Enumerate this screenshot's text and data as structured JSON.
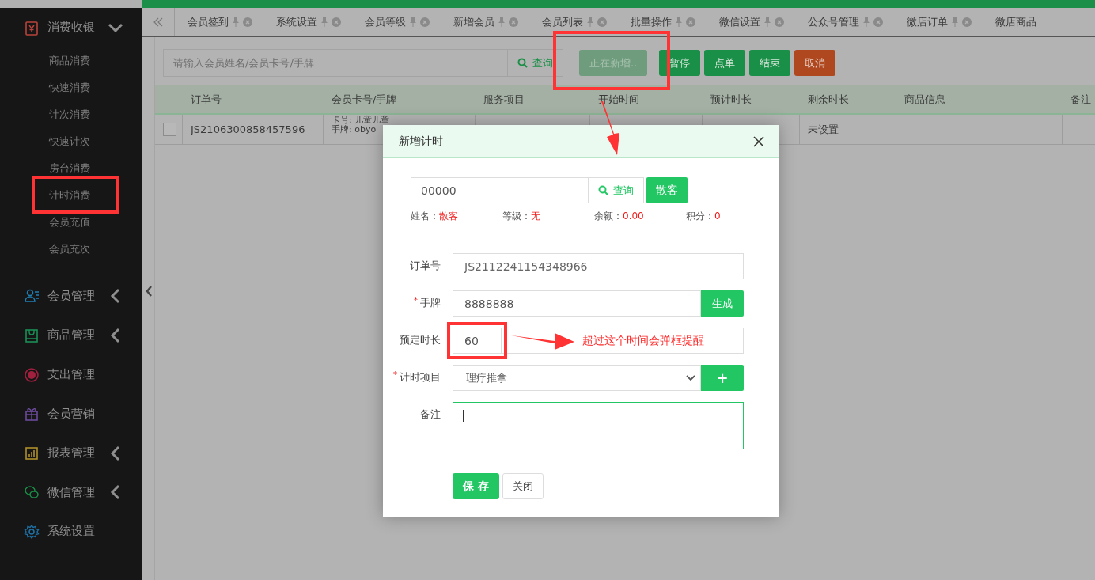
{
  "sidebar": {
    "groups": [
      {
        "label": "消费收银",
        "expanded": true,
        "collapsible": true,
        "children": [
          {
            "label": "商品消费"
          },
          {
            "label": "快速消费"
          },
          {
            "label": "计次消费"
          },
          {
            "label": "快速计次"
          },
          {
            "label": "房台消费"
          },
          {
            "label": "计时消费"
          },
          {
            "label": "会员充值"
          },
          {
            "label": "会员充次"
          }
        ]
      },
      {
        "label": "会员管理",
        "expanded": false,
        "collapsible": true
      },
      {
        "label": "商品管理",
        "expanded": false,
        "collapsible": true
      },
      {
        "label": "支出管理",
        "collapsible": false
      },
      {
        "label": "会员营销",
        "collapsible": false
      },
      {
        "label": "报表管理",
        "expanded": false,
        "collapsible": true
      },
      {
        "label": "微信管理",
        "expanded": false,
        "collapsible": true
      },
      {
        "label": "系统设置",
        "collapsible": false
      }
    ]
  },
  "tabs": [
    {
      "label": "会员签到",
      "closable": true
    },
    {
      "label": "系统设置",
      "closable": true
    },
    {
      "label": "会员等级",
      "closable": true
    },
    {
      "label": "新增会员",
      "closable": true
    },
    {
      "label": "会员列表",
      "closable": true
    },
    {
      "label": "批量操作",
      "closable": true
    },
    {
      "label": "微信设置",
      "closable": true
    },
    {
      "label": "公众号管理",
      "closable": true
    },
    {
      "label": "微店订单",
      "closable": true
    },
    {
      "label": "微店商品",
      "closable": false
    }
  ],
  "toolbar": {
    "search": {
      "placeholder": "请输入会员姓名/会员卡号/手牌"
    },
    "search_button": "查询",
    "buttons": [
      {
        "label": "正在新增..",
        "kind": "disabled"
      },
      {
        "label": "暂停",
        "kind": "primary"
      },
      {
        "label": "点单",
        "kind": "primary"
      },
      {
        "label": "结束",
        "kind": "primary"
      },
      {
        "label": "取消",
        "kind": "danger"
      }
    ]
  },
  "table": {
    "columns": [
      "订单号",
      "会员卡号/手牌",
      "服务项目",
      "开始时间",
      "预计时长",
      "剩余时长",
      "商品信息",
      "备注"
    ],
    "rows": [
      {
        "checked": false,
        "order": "JS2106300858457596",
        "card": "卡号: 儿童儿童",
        "tag": "手牌: obyo",
        "remaining": "未设置"
      }
    ]
  },
  "dialog": {
    "title": "新增计时",
    "member_field": {
      "value": "00000"
    },
    "query_button": "查询",
    "guest_button": "散客",
    "info": [
      {
        "label": "姓名：",
        "value": "散客"
      },
      {
        "label": "等级：",
        "value": "无"
      },
      {
        "label": "余额：",
        "value": "0.00"
      },
      {
        "label": "积分：",
        "value": "0"
      }
    ],
    "fields": [
      {
        "label": "订单号",
        "kind": "readonly",
        "value": "JS2112241154348966"
      },
      {
        "label": "手牌",
        "kind": "button",
        "required_mark": "*",
        "value": "8888888",
        "button": "生成"
      },
      {
        "label": "预定时长",
        "kind": "addon",
        "value": "60"
      },
      {
        "label": "计时项目",
        "kind": "select",
        "required_mark": "*",
        "value": "理疗推拿",
        "button": "+"
      },
      {
        "label": "备注",
        "kind": "textarea"
      }
    ],
    "save_button": "保 存",
    "close_button": "关闭"
  },
  "annotation": {
    "note": "超过这个时间会弹框提醒"
  }
}
